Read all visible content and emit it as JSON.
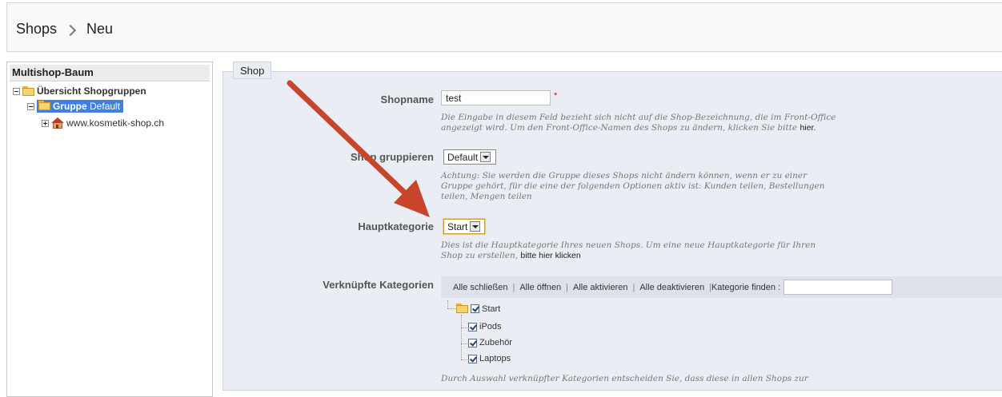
{
  "breadcrumb": {
    "root": "Shops",
    "current": "Neu"
  },
  "tree": {
    "title": "Multishop-Baum",
    "overview": "Übersicht Shopgruppen",
    "group_prefix": "Gruppe",
    "group_name": "Default",
    "shop": "www.kosmetik-shop.ch"
  },
  "form": {
    "legend": "Shop",
    "shopname": {
      "label": "Shopname",
      "value": "test",
      "required_mark": "*",
      "hint": "Die Eingabe in diesem Feld bezieht sich nicht auf die Shop-Bezeichnung, die im Front-Office angezeigt wird. Um den Front-Office-Namen des Shops zu ändern, klicken Sie bitte",
      "hint_link": "hier.",
      "hint_end": ""
    },
    "group": {
      "label": "Shop gruppieren",
      "value": "Default",
      "hint": "Achtung: Sie werden die Gruppe dieses Shops nicht ändern können, wenn er zu einer Gruppe gehört, für die eine der folgenden Optionen aktiv ist: Kunden teilen, Bestellungen teilen, Mengen teilen"
    },
    "main_category": {
      "label": "Hauptkategorie",
      "value": "Start",
      "hint": "Dies ist die Hauptkategorie Ihres neuen Shops. Um eine neue Hauptkategorie für Ihren Shop zu erstellen,",
      "hint_link": "bitte hier klicken"
    },
    "linked_categories": {
      "label": "Verknüpfte Kategorien",
      "toolbar": {
        "collapse_all": "Alle schließen",
        "expand_all": "Alle öffnen",
        "check_all": "Alle aktivieren",
        "uncheck_all": "Alle deaktivieren",
        "find_label": "Kategorie finden :"
      },
      "root": "Start",
      "children": [
        "iPods",
        "Zubehör",
        "Laptops"
      ],
      "hint": "Durch Auswahl verknüpfter Kategorien entscheiden Sie, dass diese in allen Shops zur"
    }
  },
  "colors": {
    "arrow": "#c8442a",
    "selected_node": "#3f7fe0",
    "panel_bg": "#ebedf4"
  }
}
